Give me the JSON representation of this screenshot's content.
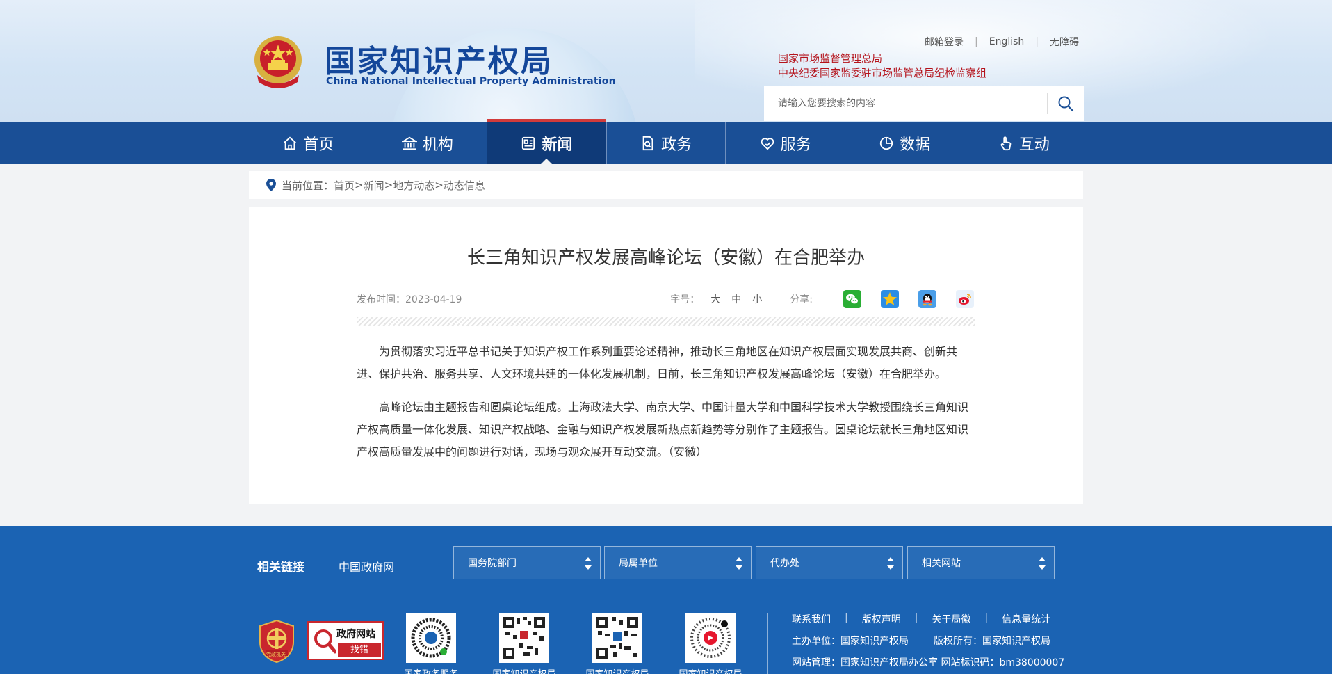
{
  "header": {
    "title": "国家知识产权局",
    "subtitle": "China National Intellectual Property Administration",
    "top_links": [
      "邮箱登录",
      "English",
      "无障碍"
    ],
    "agency_line1": "国家市场监督管理总局",
    "agency_line2": "中央纪委国家监委驻市场监管总局纪检监察组",
    "search_placeholder": "请输入您要搜索的内容"
  },
  "nav": {
    "items": [
      {
        "label": "首页",
        "icon": "home-icon"
      },
      {
        "label": "机构",
        "icon": "institution-icon"
      },
      {
        "label": "新闻",
        "icon": "news-icon",
        "active": true
      },
      {
        "label": "政务",
        "icon": "document-icon"
      },
      {
        "label": "服务",
        "icon": "heart-hand-icon"
      },
      {
        "label": "数据",
        "icon": "pie-chart-icon"
      },
      {
        "label": "互动",
        "icon": "pointer-hand-icon"
      }
    ]
  },
  "breadcrumb": {
    "prefix": "当前位置：",
    "items": [
      "首页",
      "新闻",
      "地方动态",
      "动态信息"
    ],
    "separator": ">"
  },
  "article": {
    "title": "长三角知识产权发展高峰论坛（安徽）在合肥举办",
    "publish_time": "发布时间：2023-04-19",
    "font_size_label": "字号：",
    "font_sizes": [
      "大",
      "中",
      "小"
    ],
    "share_label": "分享:",
    "share_icons": [
      "wechat-icon",
      "qzone-icon",
      "qq-icon",
      "weibo-icon"
    ],
    "paragraphs": [
      "为贯彻落实习近平总书记关于知识产权工作系列重要论述精神，推动长三角地区在知识产权层面实现发展共商、创新共进、保护共治、服务共享、人文环境共建的一体化发展机制，日前，长三角知识产权发展高峰论坛（安徽）在合肥举办。",
      "高峰论坛由主题报告和圆桌论坛组成。上海政法大学、南京大学、中国计量大学和中国科学技术大学教授围绕长三角知识产权高质量一体化发展、知识产权战略、金融与知识产权发展新热点新趋势等分别作了主题报告。圆桌论坛就长三角地区知识产权高质量发展中的问题进行对话，现场与观众展开互动交流。（安徽）"
    ]
  },
  "footer": {
    "links_label": "相关链接",
    "gov_link": "中国政府网",
    "selects": [
      "国务院部门",
      "局属单位",
      "代办处",
      "相关网站"
    ],
    "badge_party": "党政机关",
    "badge_error_top": "政府网站",
    "badge_error_bottom": "找错",
    "qr_labels": [
      "国家政务服务",
      "国家知识产权局",
      "国家知识产权局",
      "国家知识产权局"
    ],
    "links_row": [
      "联系我们",
      "版权声明",
      "关于局徽",
      "信息量统计"
    ],
    "host": "主办单位：国家知识产权局",
    "copyright": "版权所有：国家知识产权局",
    "manage": "网站管理：国家知识产权局办公室 网站标识码：bm38000007"
  },
  "colors": {
    "nav_bg": "#1a4f96",
    "nav_active": "#0f3a78",
    "brand_blue": "#14479a",
    "agency_red": "#b4121b",
    "footer_bg": "#1b63b3"
  }
}
